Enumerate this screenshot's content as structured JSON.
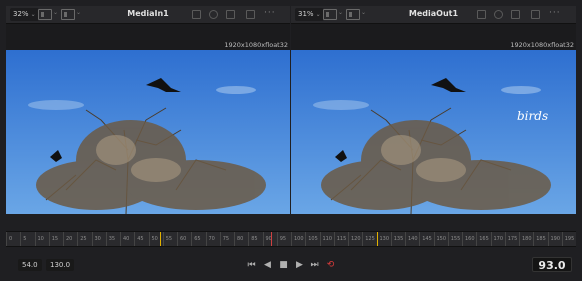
{
  "viewers": [
    {
      "zoom": "32%",
      "name": "MediaIn1",
      "resolution": "1920x1080xfloat32"
    },
    {
      "zoom": "31%",
      "name": "MediaOut1",
      "resolution": "1920x1080xfloat32",
      "overlay_text": "birds"
    }
  ],
  "ruler": {
    "ticks": [
      "0",
      "5",
      "10",
      "15",
      "20",
      "25",
      "30",
      "35",
      "40",
      "45",
      "50",
      "55",
      "60",
      "65",
      "70",
      "75",
      "80",
      "85",
      "90",
      "95",
      "100",
      "105",
      "110",
      "115",
      "120",
      "125",
      "130",
      "135",
      "140",
      "145",
      "150",
      "155",
      "160",
      "165",
      "170",
      "175",
      "180",
      "185",
      "190",
      "195"
    ],
    "playhead_color": "#e2b100",
    "in_out_color": "#d04040"
  },
  "transport": {
    "range_start": "54.0",
    "range_end": "130.0",
    "current_frame": "93.0",
    "buttons": [
      "skip-to-start",
      "step-back",
      "stop",
      "play",
      "skip-to-end",
      "loop"
    ]
  },
  "colors": {
    "accent_loop": "#e03c3c",
    "panel": "#28282b",
    "sky": "#3f7fd3"
  }
}
